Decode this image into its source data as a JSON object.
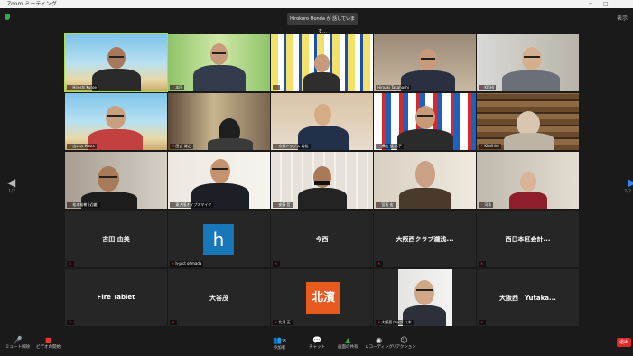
{
  "window": {
    "title": "Zoom ミーティング",
    "minimize": "─",
    "restore": "□"
  },
  "header": {
    "toast": "Hirokuro Honda が 話しています…",
    "view_label": "表示"
  },
  "nav": {
    "prev_page": "1/2",
    "next_page": "2/2"
  },
  "tiles": [
    {
      "name": "Hiroshi Kuroe",
      "muted": true
    },
    {
      "name": "本田",
      "muted": true
    },
    {
      "name": "",
      "muted": true
    },
    {
      "name": "Hiroaki Takahashi",
      "muted": false
    },
    {
      "name": "KISHI",
      "muted": true
    },
    {
      "name": "山口の Hosts",
      "muted": true
    },
    {
      "name": "田吉 博之",
      "muted": true
    },
    {
      "name": "京都トップス 若松",
      "muted": true
    },
    {
      "name": "横山 佳 木下",
      "muted": true
    },
    {
      "name": "Kimihiro",
      "muted": true
    },
    {
      "name": "松本裕樹 (近畿)",
      "muted": true
    },
    {
      "name": "東大阪オイプスマイク",
      "muted": true
    },
    {
      "name": "安藤 哲",
      "muted": true
    },
    {
      "name": "宮坂 宏",
      "muted": true
    },
    {
      "name": "河本",
      "muted": true
    },
    {
      "name": "",
      "center": "吉田 由美",
      "muted": true
    },
    {
      "name": "h-pict ohmada",
      "avatar": "h",
      "muted": true
    },
    {
      "name": "",
      "center": "今西",
      "muted": true
    },
    {
      "name": "",
      "center": "大阪西クラブ瀧浅...",
      "muted": true
    },
    {
      "name": "",
      "center": "西日本区会計...",
      "muted": true
    },
    {
      "name": "",
      "center": "Fire Tablet",
      "muted": true
    },
    {
      "name": "",
      "center": "大谷茂",
      "muted": true
    },
    {
      "name": "北濱 正",
      "avatar": "北濱",
      "muted": true
    },
    {
      "name": "大阪西クラブ 八木",
      "muted": true
    },
    {
      "name": "",
      "center": "大阪西　Yutaka...",
      "muted": true
    }
  ],
  "toolbar": {
    "mute": "ミュート解除",
    "video": "ビデオの開始",
    "participants": "参加者",
    "participants_count": "25",
    "chat": "チャット",
    "share": "画面の共有",
    "record": "レコーディング",
    "reactions": "リアクション",
    "leave": "退出"
  },
  "colors": {
    "active_speaker": "#a8e04a",
    "share_green": "#2da94f",
    "leave_red": "#e02828"
  },
  "icons": [
    "shield-icon",
    "mic-off-icon",
    "video-off-icon",
    "participants-icon",
    "chat-icon",
    "share-screen-icon",
    "record-icon",
    "reactions-icon"
  ]
}
